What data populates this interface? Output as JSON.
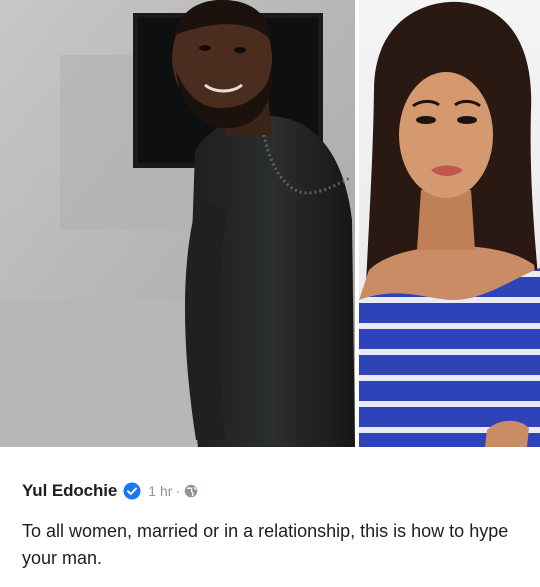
{
  "post": {
    "author": "Yul Edochie",
    "time": "1 hr",
    "separator": "·",
    "text": "To all women, married or in a relationship, this is how to hype your man."
  },
  "icons": {
    "verified": "verified-badge-icon",
    "audience": "globe-icon"
  },
  "colors": {
    "verified_blue": "#1877f2",
    "text": "#1c1e21",
    "secondary_text": "#8d949e"
  }
}
